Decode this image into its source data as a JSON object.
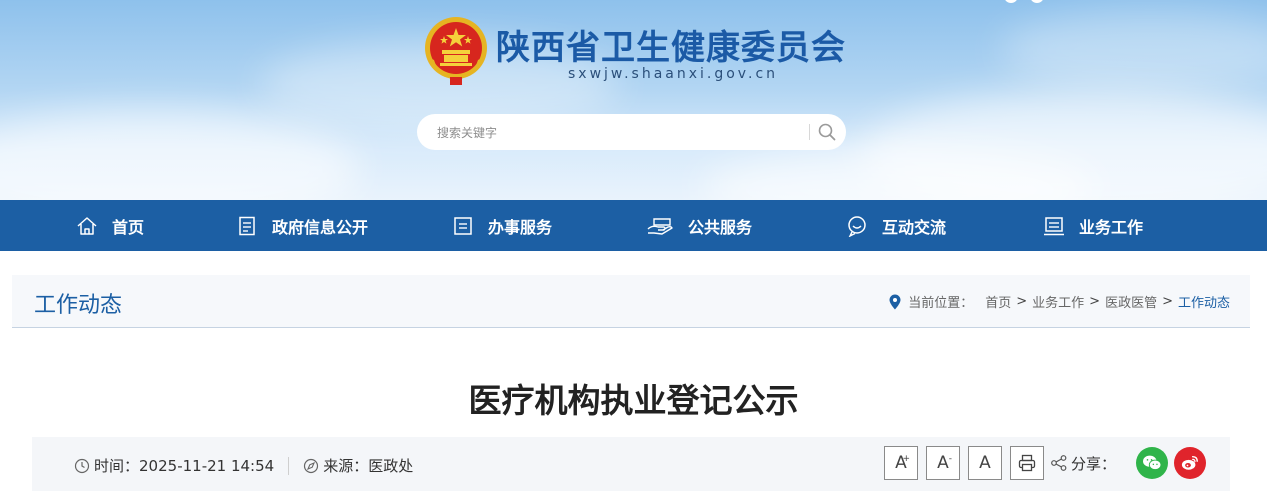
{
  "site": {
    "title": "陕西省卫生健康委员会",
    "domain": "sxwjw.shaanxi.gov.cn",
    "search_placeholder": "搜索关键字"
  },
  "nav": {
    "items": [
      {
        "label": "首页",
        "icon": "home-icon"
      },
      {
        "label": "政府信息公开",
        "icon": "document-icon"
      },
      {
        "label": "办事服务",
        "icon": "service-icon"
      },
      {
        "label": "公共服务",
        "icon": "public-service-icon"
      },
      {
        "label": "互动交流",
        "icon": "chat-icon"
      },
      {
        "label": "业务工作",
        "icon": "business-icon"
      }
    ]
  },
  "section": {
    "title": "工作动态"
  },
  "breadcrumb": {
    "label": "当前位置：",
    "items": [
      "首页",
      "业务工作",
      "医政医管",
      "工作动态"
    ],
    "separator": ">"
  },
  "article": {
    "title": "医疗机构执业登记公示",
    "time_label": "时间：",
    "time_value": "2025-11-21 14:54",
    "source_label": "来源：",
    "source_value": "医政处"
  },
  "tools": {
    "font_large": "A",
    "font_large_mark": "+",
    "font_small": "A",
    "font_small_mark": "-",
    "font_default": "A",
    "share_label": "分享："
  },
  "colors": {
    "brand_blue": "#1c5fa4",
    "wechat_green": "#2fb44a",
    "weibo_red": "#e0242c"
  }
}
